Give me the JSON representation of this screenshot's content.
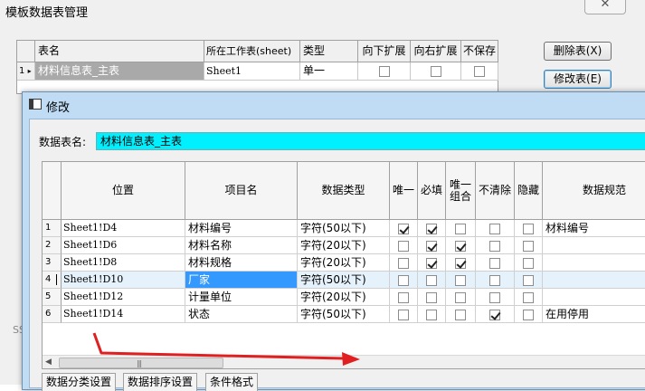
{
  "background_window": {
    "title": "模板数据表管理",
    "close_glyph": "✕",
    "table": {
      "headers": [
        "表名",
        "所在工作表(sheet)",
        "类型",
        "向下扩展",
        "向右扩展",
        "不保存"
      ],
      "row": {
        "index": "1",
        "marker": "▸",
        "name": "材料信息表_主表",
        "sheet": "Sheet1",
        "type": "单一",
        "expand_down": false,
        "expand_right": false,
        "no_save": false
      }
    },
    "buttons": {
      "delete": "删除表(X)",
      "modify": "修改表(E)"
    },
    "left_stub": "SS"
  },
  "dialog": {
    "title": "修改",
    "name_label": "数据表名:",
    "name_value": "材料信息表_主表",
    "columns": [
      "位置",
      "项目名",
      "数据类型",
      "唯一",
      "必填",
      "唯一组合",
      "不清除",
      "隐藏",
      "数据规范"
    ],
    "rows": [
      {
        "index": "1",
        "position": "Sheet1!D4",
        "item": "材料编号",
        "dtype": "字符(50以下)",
        "unique": true,
        "required": true,
        "unique_combo": false,
        "no_clear": false,
        "hidden": false,
        "spec": "材料编号"
      },
      {
        "index": "2",
        "position": "Sheet1!D6",
        "item": "材料名称",
        "dtype": "字符(20以下)",
        "unique": false,
        "required": true,
        "unique_combo": true,
        "no_clear": false,
        "hidden": false,
        "spec": ""
      },
      {
        "index": "3",
        "position": "Sheet1!D8",
        "item": "材料规格",
        "dtype": "字符(20以下)",
        "unique": false,
        "required": true,
        "unique_combo": true,
        "no_clear": false,
        "hidden": false,
        "spec": ""
      },
      {
        "index": "4",
        "position": "Sheet1!D10",
        "item": "厂家",
        "dtype": "字符(50以下)",
        "unique": false,
        "required": false,
        "unique_combo": false,
        "no_clear": false,
        "hidden": false,
        "spec": ""
      },
      {
        "index": "5",
        "position": "Sheet1!D12",
        "item": "计量单位",
        "dtype": "字符(20以下)",
        "unique": false,
        "required": false,
        "unique_combo": false,
        "no_clear": false,
        "hidden": false,
        "spec": ""
      },
      {
        "index": "6",
        "position": "Sheet1!D14",
        "item": "状态",
        "dtype": "字符(50以下)",
        "unique": false,
        "required": false,
        "unique_combo": false,
        "no_clear": true,
        "hidden": false,
        "spec": "在用停用"
      }
    ],
    "selected_row_index": 3,
    "scroll_left_glyph": "◀",
    "scroll_grip": "|||",
    "tabs": [
      "数据分类设置",
      "数据排序设置",
      "条件格式"
    ]
  },
  "colors": {
    "accent_cyan": "#00f0ff",
    "selection_blue": "#3399ff",
    "annotation_red": "#e02020",
    "dialog_frame": "#bfdcf4"
  }
}
